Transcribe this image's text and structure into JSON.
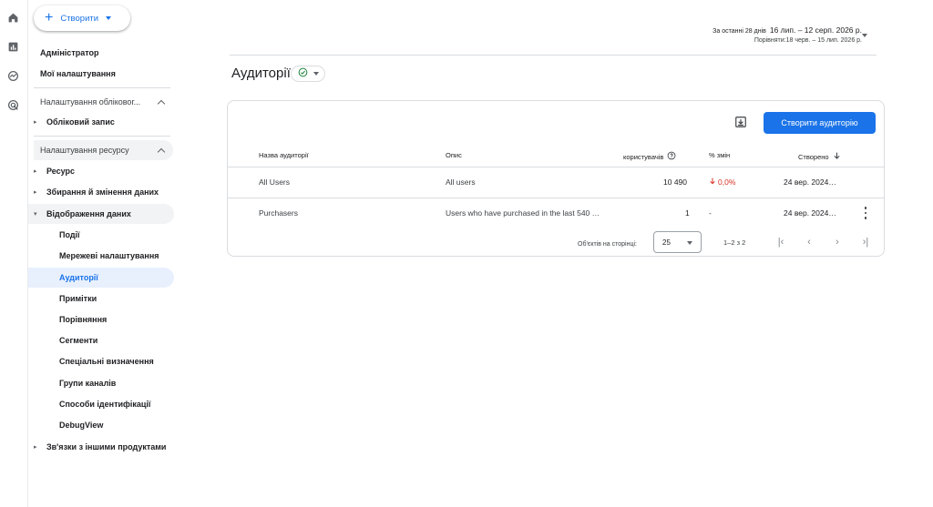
{
  "rail": {
    "icons": [
      "home-icon",
      "reports-icon",
      "explore-icon",
      "advertising-icon"
    ]
  },
  "nav": {
    "create_label": "Створити",
    "admin": "Адміністратор",
    "my_settings": "Мої налаштування",
    "account_settings_hdr": "Налаштування обліковог...",
    "account": "Обліковий запис",
    "property_settings_hdr": "Налаштування ресурсу",
    "property": "Ресурс",
    "data_collection": "Збирання й змінення даних",
    "data_display": "Відображення даних",
    "events": "Події",
    "network_settings": "Мережеві налаштування",
    "audiences": "Аудиторії",
    "annotations": "Примітки",
    "comparisons": "Порівняння",
    "segments": "Сегменти",
    "custom_definitions": "Спеціальні визначення",
    "channel_groups": "Групи каналів",
    "identification": "Способи ідентифікації",
    "debugview": "DebugView",
    "product_links": "Зв'язки з іншими продуктами"
  },
  "date_range": {
    "label": "За останні 28 днів",
    "range": "16 лип. – 12 серп. 2026 р.",
    "compare": "Порівняти:18 черв. – 15 лип. 2026 р."
  },
  "page": {
    "title": "Аудиторії"
  },
  "table": {
    "create_button": "Створити аудиторію",
    "columns": {
      "name": "Назва аудиторії",
      "description": "Опис",
      "users": "користувачів",
      "change": "% змін",
      "created": "Створено"
    },
    "rows": [
      {
        "name": "All Users",
        "description": "All users",
        "users": "10 490",
        "change": "0,0%",
        "created": "24 вер. 2024…"
      },
      {
        "name": "Purchasers",
        "description": "Users who have purchased in the last 540 …",
        "users": "1",
        "change": "-",
        "created": "24 вер. 2024…"
      }
    ],
    "pager": {
      "per_page_label": "Об'єктів на сторінці:",
      "per_page_value": "25",
      "range": "1–2 з 2"
    }
  },
  "colors": {
    "accent": "#1a73e8",
    "negative": "#d93025",
    "success": "#188038"
  }
}
